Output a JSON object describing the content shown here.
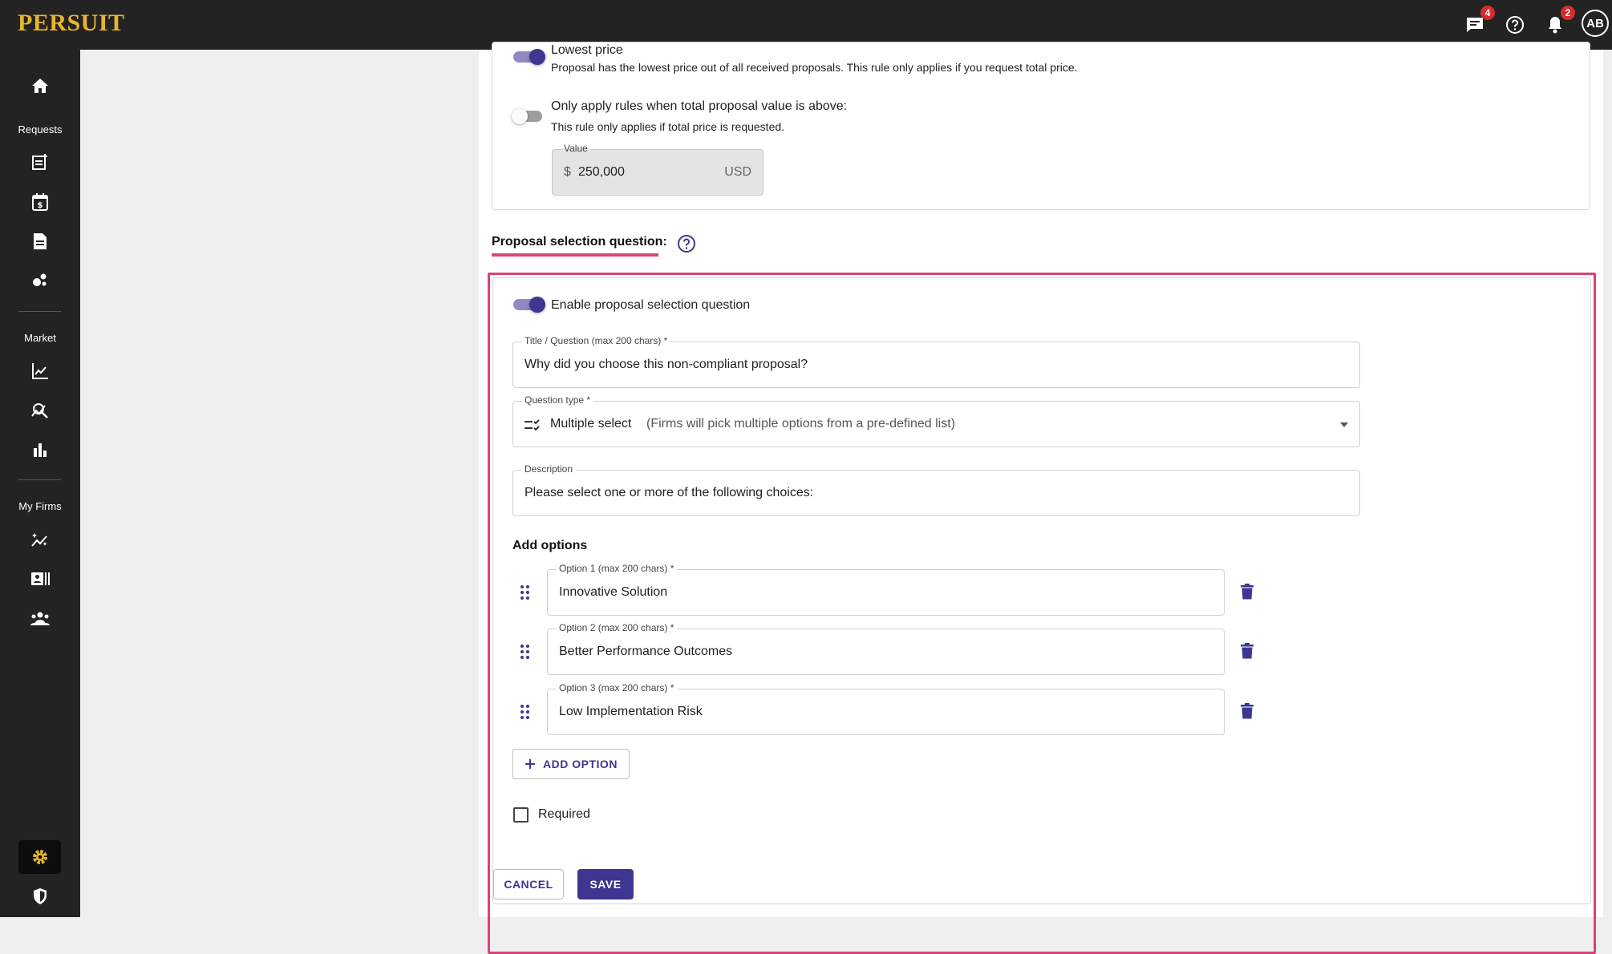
{
  "app": {
    "brand": "PERSUIT"
  },
  "topbar": {
    "messages_badge": "4",
    "notifications_badge": "2",
    "avatar_initials": "AB"
  },
  "sidebar": {
    "sections": {
      "requests": "Requests",
      "market": "Market",
      "my_firms": "My Firms"
    }
  },
  "rules": {
    "lowest_price_title": "Lowest price",
    "lowest_price_desc": "Proposal has the lowest price out of all received proposals. This rule only applies if you request total price.",
    "threshold_title": "Only apply rules when total proposal value is above:",
    "threshold_desc": "This rule only applies if total price is requested.",
    "value_label": "Value",
    "value_prefix": "$",
    "value": "250,000",
    "value_currency": "USD"
  },
  "selection": {
    "heading": "Proposal selection question:",
    "enable_label": "Enable proposal selection question",
    "title_label": "Title / Question (max 200 chars) *",
    "title_value": "Why did you choose this non-compliant proposal?",
    "type_label": "Question type *",
    "type_value": "Multiple select",
    "type_hint": "(Firms will pick multiple options from a pre-defined list)",
    "description_label": "Description",
    "description_value": "Please select one or more of the following choices:",
    "add_options_heading": "Add options",
    "options": [
      {
        "label": "Option 1 (max 200 chars) *",
        "value": "Innovative Solution"
      },
      {
        "label": "Option 2 (max 200 chars) *",
        "value": "Better Performance Outcomes"
      },
      {
        "label": "Option 3 (max 200 chars) *",
        "value": "Low Implementation Risk"
      }
    ],
    "add_option_button": "ADD OPTION",
    "required_label": "Required"
  },
  "actions": {
    "cancel": "CANCEL",
    "save": "SAVE"
  }
}
